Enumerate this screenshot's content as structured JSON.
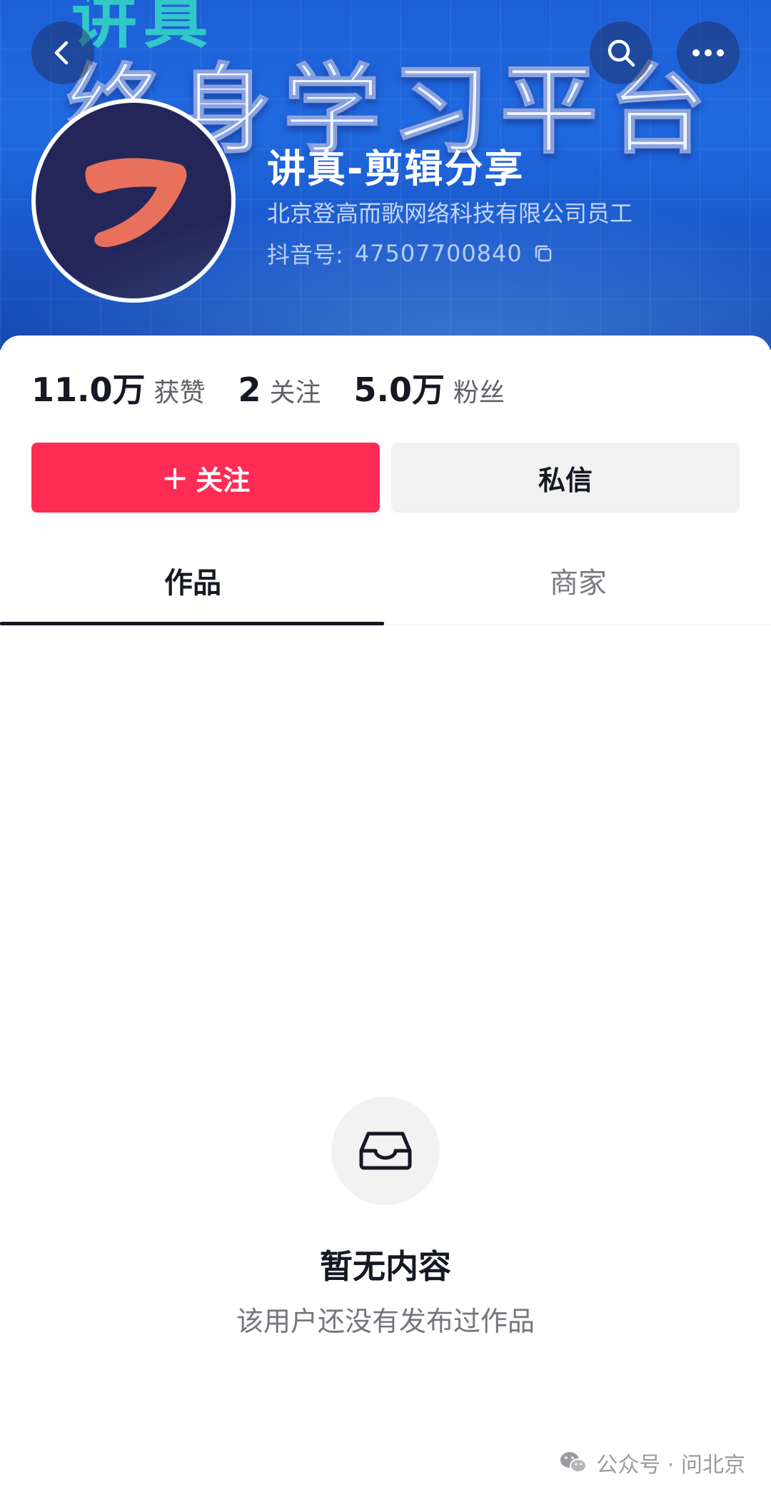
{
  "banner": {
    "top_text": "讲真",
    "slogan": "终身学习平台"
  },
  "profile": {
    "nickname": "讲真-剪辑分享",
    "verification": "北京登高而歌网络科技有限公司员工",
    "douyin_id_label": "抖音号:",
    "douyin_id": "47507700840"
  },
  "stats": [
    {
      "value": "11.0万",
      "label": "获赞"
    },
    {
      "value": "2",
      "label": "关注"
    },
    {
      "value": "5.0万",
      "label": "粉丝"
    }
  ],
  "actions": {
    "follow_plus": "+",
    "follow_label": "关注",
    "message_label": "私信"
  },
  "tabs": [
    {
      "label": "作品",
      "active": true
    },
    {
      "label": "商家",
      "active": false
    }
  ],
  "empty_state": {
    "title": "暂无内容",
    "description": "该用户还没有发布过作品"
  },
  "watermark": {
    "text": "公众号 · 问北京"
  },
  "colors": {
    "follow_button": "#fe2c55",
    "banner": "#1f6ae0",
    "avatar_bg": "#24265a",
    "logo": "#e8705c"
  }
}
